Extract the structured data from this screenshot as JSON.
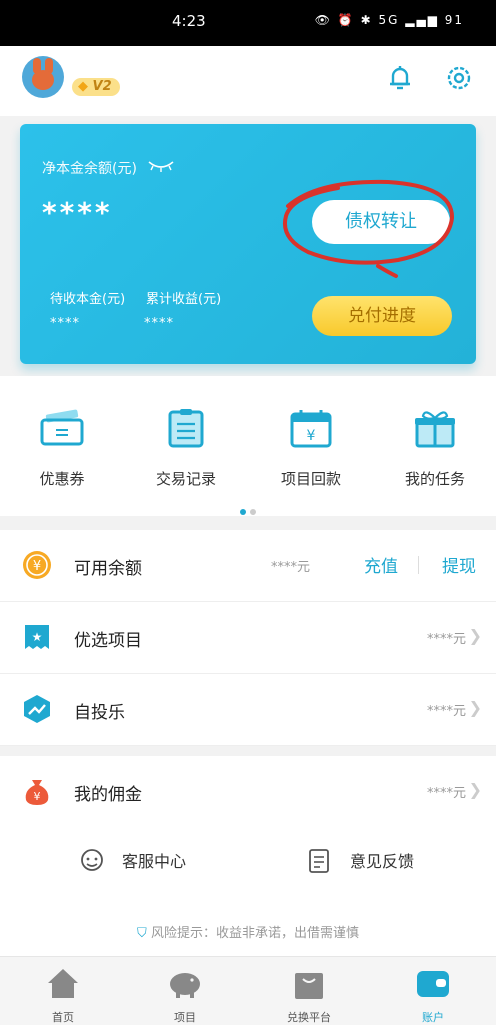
{
  "status_bar": {
    "time": "4:23",
    "icons": "👁 ⏰ ✱ 5G ▂▄▆ 91"
  },
  "header": {
    "vip_level": "V2"
  },
  "card": {
    "net_principal_label": "净本金余额(元)",
    "net_principal_value": "****",
    "transfer_button": "债权转让",
    "pending_principal_label": "待收本金(元)",
    "pending_principal_value": "****",
    "cumulative_earnings_label": "累计收益(元)",
    "cumulative_earnings_value": "****",
    "progress_button": "兑付进度"
  },
  "quick_actions": [
    {
      "label": "优惠券",
      "icon": "coupon-icon"
    },
    {
      "label": "交易记录",
      "icon": "clipboard-icon"
    },
    {
      "label": "项目回款",
      "icon": "calendar-icon"
    },
    {
      "label": "我的任务",
      "icon": "gift-icon"
    }
  ],
  "rows": [
    {
      "label": "可用余额",
      "value": "****元",
      "recharge": "充值",
      "withdraw": "提现"
    },
    {
      "label": "优选项目",
      "value": "****元"
    },
    {
      "label": "自投乐",
      "value": "****元"
    },
    {
      "label": "我的佣金",
      "value": "****元"
    }
  ],
  "services": {
    "customer_service": "客服中心",
    "feedback": "意见反馈"
  },
  "risk_notice": "风险提示：收益非承诺，出借需谨慎",
  "tabs": [
    {
      "label": "首页",
      "icon": "home-icon"
    },
    {
      "label": "项目",
      "icon": "piggy-bank-icon"
    },
    {
      "label": "兑换平台",
      "icon": "shopping-bag-icon"
    },
    {
      "label": "账户",
      "icon": "wallet-icon",
      "active": true
    }
  ],
  "colors": {
    "accent": "#1fa8d0",
    "card": "#26b9e0",
    "gold": "#f8c92c",
    "annotation": "#d9332b"
  }
}
